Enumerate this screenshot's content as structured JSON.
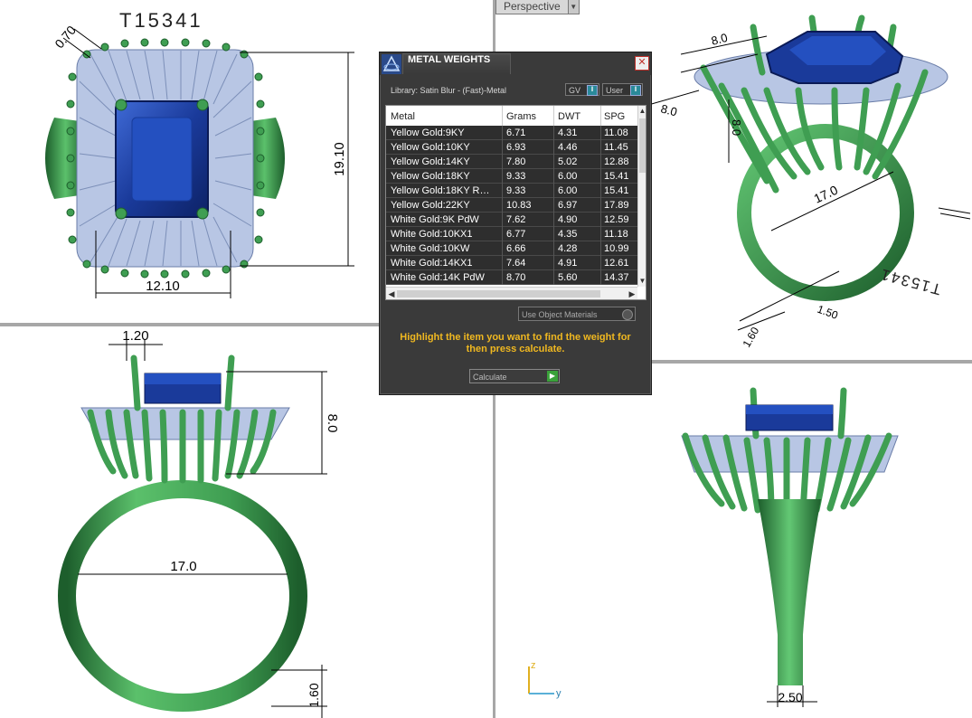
{
  "views": {
    "top": {
      "model_code": "T15341",
      "dims": {
        "prong": "0.70",
        "height": "19.10",
        "width": "12.10"
      }
    },
    "perspective": {
      "viewport_label": "Perspective",
      "model_code": "T15341",
      "dims": {
        "d1": "8.0",
        "d2": "17.0",
        "d3": "1.60",
        "d4": "8.0",
        "d5": "1.50"
      }
    },
    "front": {
      "dims": {
        "prong": "1.20",
        "height": "8.0",
        "inner": "17.0",
        "band": "1.60"
      }
    },
    "side": {
      "dims": {
        "band": "2.50"
      },
      "axis": {
        "z": "z",
        "y": "y"
      }
    }
  },
  "dialog": {
    "title": "METAL WEIGHTS",
    "close": "✕",
    "library": "Library: Satin Blur - (Fast)-Metal",
    "gv_label": "GV",
    "user_label": "User",
    "columns": [
      "Metal",
      "Grams",
      "DWT",
      "SPG"
    ],
    "rows": [
      {
        "metal": "Yellow Gold:9KY",
        "grams": "6.71",
        "dwt": "4.31",
        "spg": "11.08"
      },
      {
        "metal": "Yellow Gold:10KY",
        "grams": "6.93",
        "dwt": "4.46",
        "spg": "11.45"
      },
      {
        "metal": "Yellow Gold:14KY",
        "grams": "7.80",
        "dwt": "5.02",
        "spg": "12.88"
      },
      {
        "metal": "Yellow Gold:18KY",
        "grams": "9.33",
        "dwt": "6.00",
        "spg": "15.41"
      },
      {
        "metal": "Yellow Gold:18KY R…",
        "grams": "9.33",
        "dwt": "6.00",
        "spg": "15.41"
      },
      {
        "metal": "Yellow Gold:22KY",
        "grams": "10.83",
        "dwt": "6.97",
        "spg": "17.89"
      },
      {
        "metal": "White Gold:9K PdW",
        "grams": "7.62",
        "dwt": "4.90",
        "spg": "12.59"
      },
      {
        "metal": "White Gold:10KX1",
        "grams": "6.77",
        "dwt": "4.35",
        "spg": "11.18"
      },
      {
        "metal": "White Gold:10KW",
        "grams": "6.66",
        "dwt": "4.28",
        "spg": "10.99"
      },
      {
        "metal": "White Gold:14KX1",
        "grams": "7.64",
        "dwt": "4.91",
        "spg": "12.61"
      },
      {
        "metal": "White Gold:14K PdW",
        "grams": "8.70",
        "dwt": "5.60",
        "spg": "14.37"
      }
    ],
    "use_object_materials": "Use Object Materials",
    "hint": "Highlight the item you want to find the weight for then press calculate.",
    "calculate": "Calculate"
  },
  "colors": {
    "metal": "#3f9e52",
    "metal_dark": "#1d5e2c",
    "gem": "#1a3a9a",
    "baguette": "#b8c6e4",
    "dialog_bg": "#3a3a3a",
    "hint": "#f0b820"
  }
}
